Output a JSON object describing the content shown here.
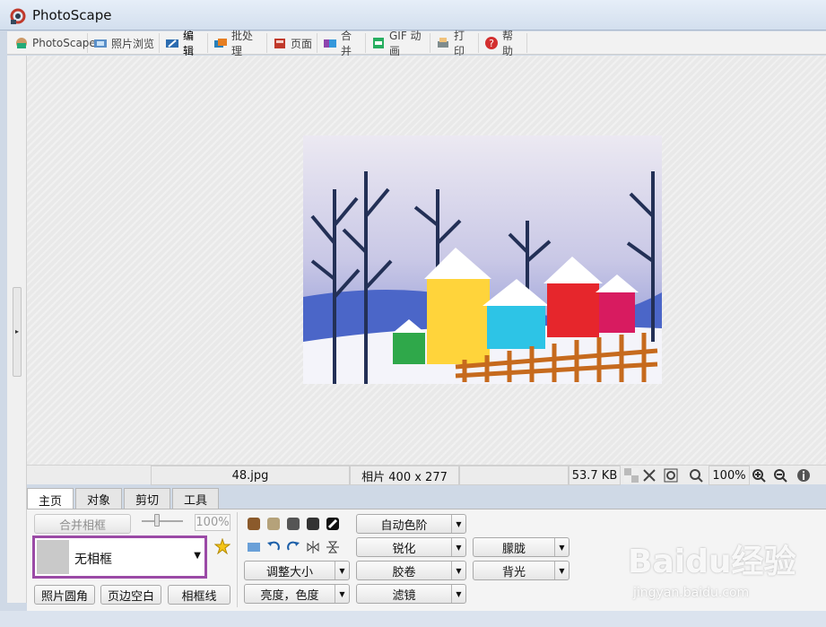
{
  "window": {
    "title": "PhotoScape"
  },
  "menu": {
    "items": [
      {
        "label": "PhotoScape",
        "icon": "photoscape-icon"
      },
      {
        "label": "照片浏览",
        "icon": "viewer-icon"
      },
      {
        "label": "编辑",
        "icon": "editor-icon"
      },
      {
        "label": "批处理",
        "icon": "batch-icon"
      },
      {
        "label": "页面",
        "icon": "page-icon"
      },
      {
        "label": "合并",
        "icon": "combine-icon"
      },
      {
        "label": "GIF 动画",
        "icon": "gif-icon"
      },
      {
        "label": "打印",
        "icon": "print-icon"
      },
      {
        "label": "帮助",
        "icon": "help-icon"
      }
    ],
    "active": "编辑"
  },
  "status": {
    "filename": "48.jpg",
    "dimensions": "相片 400 x 277",
    "filesize": "53.7 KB",
    "zoom": "100%"
  },
  "tabs": [
    "主页",
    "对象",
    "剪切",
    "工具"
  ],
  "home": {
    "merge_frame": "合并相框",
    "frame_percent": "100%",
    "frame_value": "无相框",
    "round_button": "照片圆角",
    "margin_button": "页边空白",
    "frame_line_button": "相框线",
    "resize": "调整大小",
    "brightness": "亮度，色度",
    "auto_level": "自动色阶",
    "sharpen": "锐化",
    "film": "胶卷",
    "filter": "滤镜",
    "blur": "朦胧",
    "backlight": "背光"
  },
  "watermark": {
    "brand": "Baidu经验",
    "url": "jingyan.baidu.com"
  },
  "colors": {
    "frame_highlight": "#9b4aa6",
    "canvas_bg": "#e9e9e9"
  }
}
